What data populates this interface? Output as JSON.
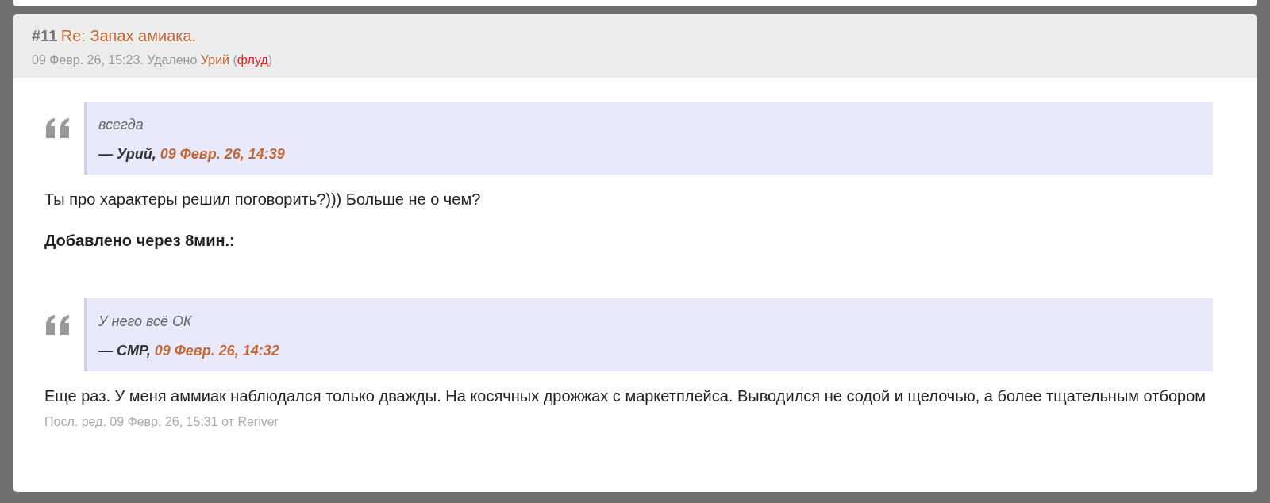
{
  "post": {
    "number": "#11",
    "title": "Re: Запах амиака.",
    "meta": [
      {
        "kind": "plain",
        "text": "09 Февр. 26, 15:23. Удалено"
      },
      {
        "kind": "user",
        "text": "Урий"
      },
      {
        "kind": "plain",
        "text": "("
      },
      {
        "kind": "reason",
        "text": "флуд"
      },
      {
        "kind": "plain",
        "text": ")"
      }
    ],
    "blocks": [
      {
        "kind": "quote",
        "text": "всегда",
        "author": "— Урий,",
        "date": "09 Февр. 26, 14:39"
      },
      {
        "kind": "paragraph",
        "text": "Ты про характеры решил поговорить?))) Больше не о чем?"
      },
      {
        "kind": "heading",
        "text": "Добавлено через 8мин.:"
      },
      {
        "kind": "quote",
        "text": "У него всё ОК",
        "author": "— СМР,",
        "date": "09 Февр. 26, 14:32"
      },
      {
        "kind": "paragraph",
        "text": "Еще раз. У меня аммиак наблюдался только дважды. На косячных дрожжах с маркетплейса. Выводился не содой и щелочью, а более тщательным отбором"
      }
    ],
    "edit_note": "Посл. ред. 09 Февр. 26, 15:31 от Reriver"
  }
}
